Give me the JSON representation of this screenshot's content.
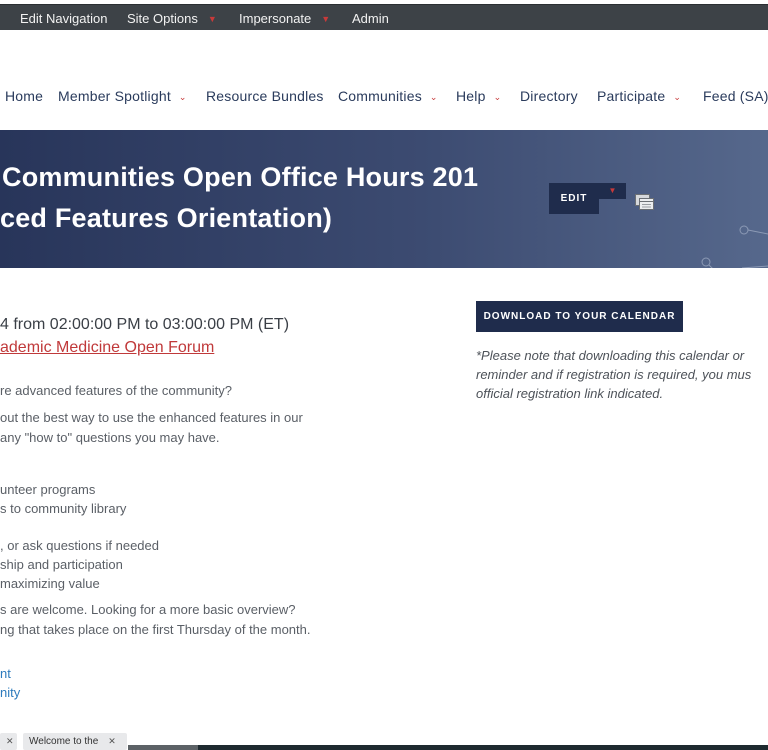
{
  "admin_bar": {
    "items": [
      {
        "label": "Edit Navigation",
        "has_menu": false
      },
      {
        "label": "Site Options",
        "has_menu": true
      },
      {
        "label": "Impersonate",
        "has_menu": true
      },
      {
        "label": "Admin",
        "has_menu": false
      }
    ]
  },
  "main_nav": {
    "items": [
      {
        "label": "Home",
        "has_menu": false
      },
      {
        "label": "Member Spotlight",
        "has_menu": true
      },
      {
        "label": "Resource Bundles",
        "has_menu": false
      },
      {
        "label": "Communities",
        "has_menu": true
      },
      {
        "label": "Help",
        "has_menu": true
      },
      {
        "label": "Directory",
        "has_menu": false
      },
      {
        "label": "Participate",
        "has_menu": true
      },
      {
        "label": "Feed (SA)",
        "has_menu": false
      }
    ]
  },
  "hero": {
    "title_line_1": "Communities Open Office Hours 201",
    "title_line_2": "ced Features Orientation)"
  },
  "actions": {
    "edit_label": "EDIT",
    "download_label": "DOWNLOAD TO YOUR CALENDAR"
  },
  "event": {
    "datetime": "4 from 02:00:00 PM to 03:00:00 PM (ET)",
    "community_link": "ademic Medicine Open Forum"
  },
  "body": {
    "p1": "re advanced features of the community?",
    "p2_line1": "out the best way to use the enhanced features in our",
    "p2_line2": "any \"how to\" questions you may have.",
    "list_a_1": "unteer programs",
    "list_a_2": "s to community library",
    "list_b_1": ", or ask questions if needed",
    "list_b_2": "ship and participation",
    "list_b_3": "maximizing value",
    "p3_line1": "s are welcome.  Looking for a more basic overview?",
    "p3_line2": "ng that takes place on the first Thursday of the month.",
    "link_1": "nt",
    "link_2": "nity"
  },
  "note": {
    "line1": "*Please note that downloading this calendar or",
    "line2": "reminder and if registration is required, you mus",
    "line3": "official registration link indicated."
  },
  "tags": [
    {
      "label": ""
    },
    {
      "label": "Welcome to the"
    }
  ],
  "colors": {
    "admin_bar_bg": "#3d4247",
    "nav_text": "#2a3b5c",
    "accent_red": "#c83a3a",
    "hero_bg_start": "#28355a",
    "hero_bg_end": "#56688c",
    "button_bg": "#1f2c4c",
    "link_blue": "#2e7bbd",
    "link_red": "#c0393a"
  },
  "icons": {
    "menu_caret": "chevron-down-icon",
    "calendar": "calendar-icon",
    "tag_remove": "close-icon"
  }
}
